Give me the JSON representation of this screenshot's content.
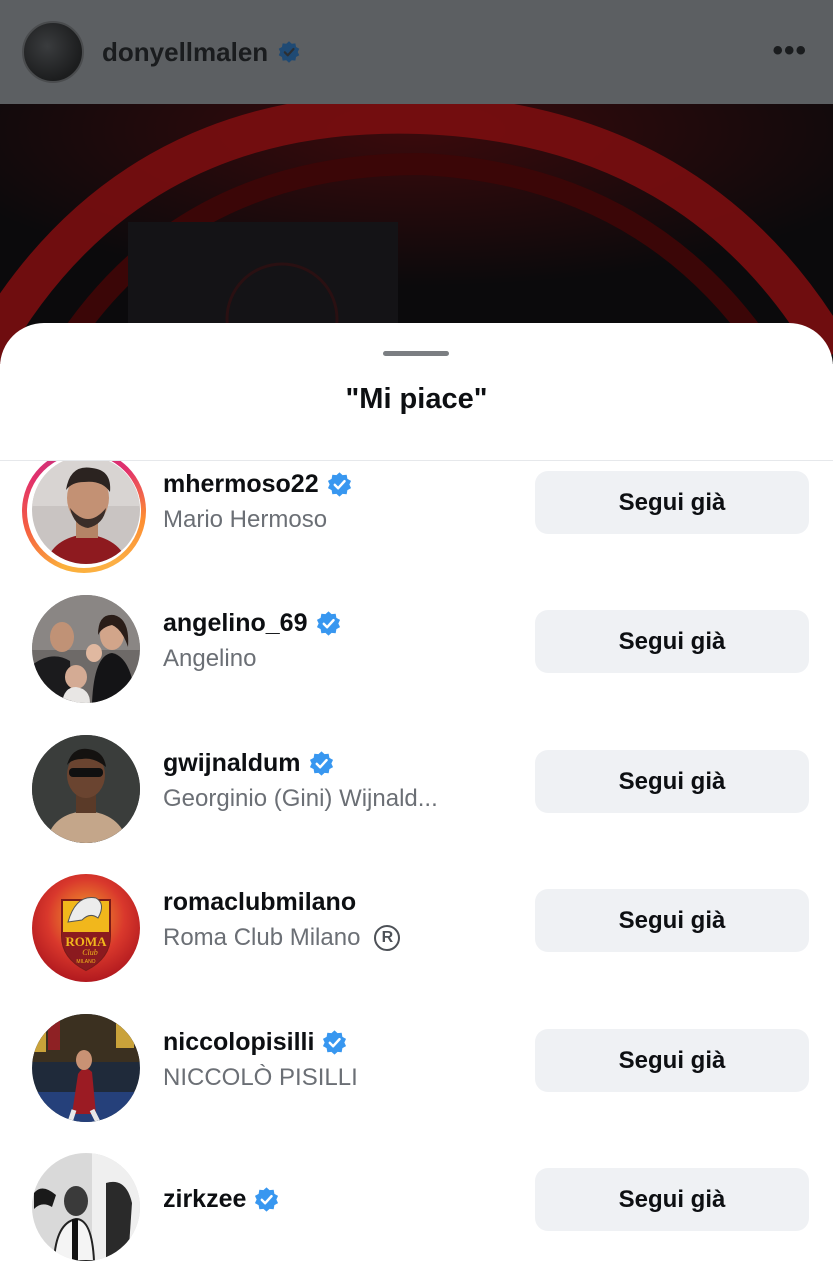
{
  "post_header": {
    "username": "donyellmalen",
    "more_label": "•••"
  },
  "sheet": {
    "title": "\"Mi piace\""
  },
  "likers": [
    {
      "username": "mhermoso22",
      "full_name": "Mario Hermoso",
      "verified": true,
      "button": "Segui già"
    },
    {
      "username": "angelino_69",
      "full_name": "Angelino",
      "verified": true,
      "button": "Segui già"
    },
    {
      "username": "gwijnaldum",
      "full_name": "Georginio (Gini) Wijnald...",
      "verified": true,
      "button": "Segui già"
    },
    {
      "username": "romaclubmilano",
      "full_name": "Roma Club Milano",
      "registered_mark": "R",
      "verified": false,
      "button": "Segui già"
    },
    {
      "username": "niccolopisilli",
      "full_name": "NICCOLÒ PISILLI",
      "verified": true,
      "button": "Segui già"
    },
    {
      "username": "zirkzee",
      "full_name": "",
      "verified": true,
      "button": "Segui già"
    }
  ],
  "avatar_badge_text": {
    "roma_club": "ROMA",
    "roma_club_sub": "Club",
    "roma_club_city": "MILANO"
  },
  "colors": {
    "verified_blue": "#3897f0",
    "button_bg": "#eff1f4"
  }
}
